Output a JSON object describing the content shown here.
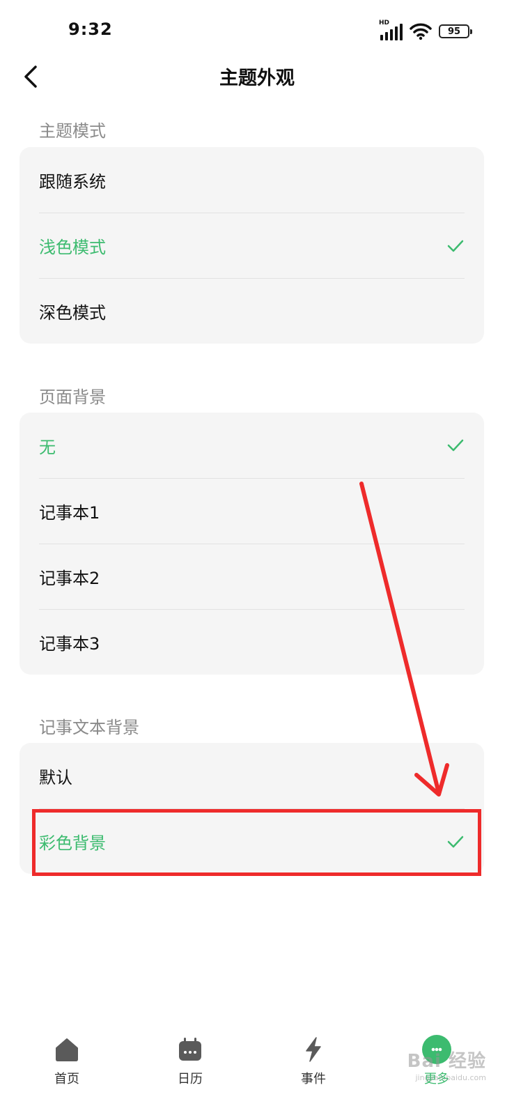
{
  "status_bar": {
    "time": "9:32",
    "network": "HD",
    "battery": "95"
  },
  "header": {
    "title": "主题外观"
  },
  "sections": [
    {
      "label": "主题模式",
      "items": [
        {
          "label": "跟随系统",
          "selected": false
        },
        {
          "label": "浅色模式",
          "selected": true
        },
        {
          "label": "深色模式",
          "selected": false
        }
      ]
    },
    {
      "label": "页面背景",
      "items": [
        {
          "label": "无",
          "selected": true
        },
        {
          "label": "记事本1",
          "selected": false
        },
        {
          "label": "记事本2",
          "selected": false
        },
        {
          "label": "记事本3",
          "selected": false
        }
      ]
    },
    {
      "label": "记事文本背景",
      "items": [
        {
          "label": "默认",
          "selected": false
        },
        {
          "label": "彩色背景",
          "selected": true
        }
      ]
    }
  ],
  "bottom_nav": {
    "items": [
      {
        "label": "首页",
        "icon": "home-icon",
        "active": false
      },
      {
        "label": "日历",
        "icon": "calendar-icon",
        "active": false
      },
      {
        "label": "事件",
        "icon": "lightning-icon",
        "active": false
      },
      {
        "label": "更多",
        "icon": "more-icon",
        "active": true
      }
    ]
  },
  "watermark": {
    "text": "Bai 经验",
    "sub": "jingyan.baidu.com"
  },
  "colors": {
    "accent": "#3cbb6f",
    "annotation": "#ee2b2b",
    "card_bg": "#f5f5f5",
    "section_label": "#8a8a8a"
  }
}
